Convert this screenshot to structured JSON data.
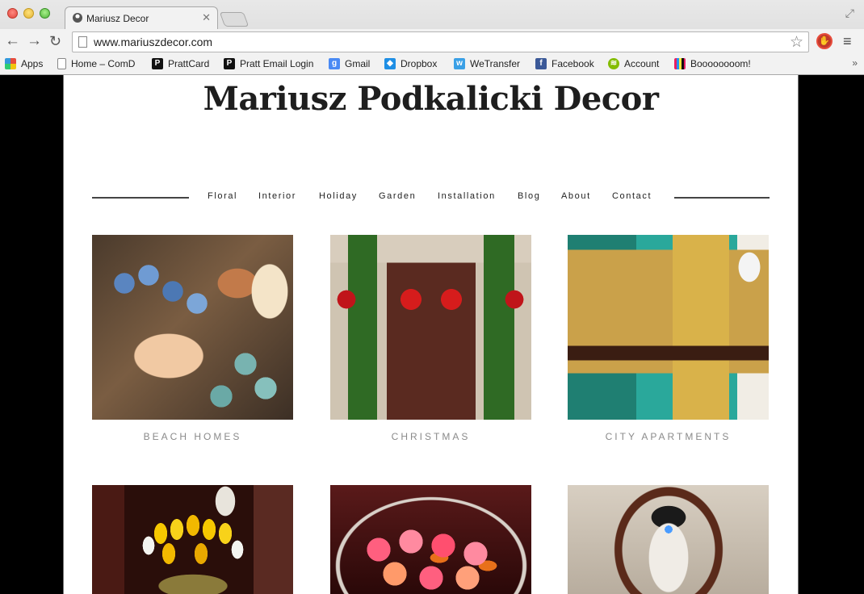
{
  "browser": {
    "tab_title": "Mariusz Decor",
    "url": "www.mariuszdecor.com",
    "bookmarks": [
      {
        "label": "Apps",
        "icon": "apps-grid-icon"
      },
      {
        "label": "Home – ComD",
        "icon": "page-icon"
      },
      {
        "label": "PrattCard",
        "icon": "pratt-p-icon"
      },
      {
        "label": "Pratt Email Login",
        "icon": "pratt-p-icon"
      },
      {
        "label": "Gmail",
        "icon": "google-icon"
      },
      {
        "label": "Dropbox",
        "icon": "dropbox-icon"
      },
      {
        "label": "WeTransfer",
        "icon": "wetransfer-icon"
      },
      {
        "label": "Facebook",
        "icon": "facebook-icon"
      },
      {
        "label": "Account",
        "icon": "spotify-icon"
      },
      {
        "label": "Boooooooom!",
        "icon": "boooooom-icon"
      }
    ],
    "more": "»"
  },
  "site": {
    "title": "Mariusz Podkalicki Decor",
    "nav": [
      "Floral",
      "Interior",
      "Holiday",
      "Garden",
      "Installation",
      "Blog",
      "About",
      "Contact"
    ]
  },
  "gallery": [
    {
      "caption": "BEACH HOMES"
    },
    {
      "caption": "CHRISTMAS"
    },
    {
      "caption": "CITY APARTMENTS"
    },
    {
      "caption": ""
    },
    {
      "caption": ""
    },
    {
      "caption": ""
    }
  ]
}
